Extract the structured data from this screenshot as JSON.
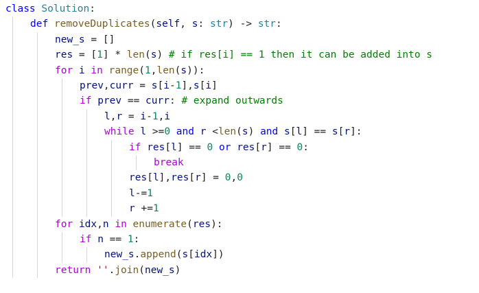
{
  "lines": [
    {
      "indent": 0,
      "tokens": [
        {
          "t": "class",
          "k": "kw"
        },
        {
          "t": " "
        },
        {
          "t": "Solution",
          "k": "cls"
        },
        {
          "t": ":"
        }
      ]
    },
    {
      "indent": 1,
      "tokens": [
        {
          "t": "def",
          "k": "kw"
        },
        {
          "t": " "
        },
        {
          "t": "removeDuplicates",
          "k": "fn"
        },
        {
          "t": "("
        },
        {
          "t": "self",
          "k": "param"
        },
        {
          "t": ", "
        },
        {
          "t": "s",
          "k": "param"
        },
        {
          "t": ": "
        },
        {
          "t": "str",
          "k": "cls"
        },
        {
          "t": ") -> "
        },
        {
          "t": "str",
          "k": "cls"
        },
        {
          "t": ":"
        }
      ]
    },
    {
      "indent": 2,
      "tokens": [
        {
          "t": "new_s",
          "k": "param"
        },
        {
          "t": " = []"
        }
      ]
    },
    {
      "indent": 2,
      "tokens": [
        {
          "t": "res",
          "k": "param"
        },
        {
          "t": " = ["
        },
        {
          "t": "1",
          "k": "num"
        },
        {
          "t": "] * "
        },
        {
          "t": "len",
          "k": "fn"
        },
        {
          "t": "("
        },
        {
          "t": "s",
          "k": "param"
        },
        {
          "t": ") "
        },
        {
          "t": "# if res[i] == 1 then it can be added into s",
          "k": "cmt"
        }
      ]
    },
    {
      "indent": 2,
      "tokens": [
        {
          "t": "for",
          "k": "ctl"
        },
        {
          "t": " "
        },
        {
          "t": "i",
          "k": "param"
        },
        {
          "t": " "
        },
        {
          "t": "in",
          "k": "ctl"
        },
        {
          "t": " "
        },
        {
          "t": "range",
          "k": "fn"
        },
        {
          "t": "("
        },
        {
          "t": "1",
          "k": "num"
        },
        {
          "t": ","
        },
        {
          "t": "len",
          "k": "fn"
        },
        {
          "t": "("
        },
        {
          "t": "s",
          "k": "param"
        },
        {
          "t": ")):"
        }
      ]
    },
    {
      "indent": 3,
      "tokens": [
        {
          "t": "prev",
          "k": "param"
        },
        {
          "t": ","
        },
        {
          "t": "curr",
          "k": "param"
        },
        {
          "t": " = "
        },
        {
          "t": "s",
          "k": "param"
        },
        {
          "t": "["
        },
        {
          "t": "i",
          "k": "param"
        },
        {
          "t": "-"
        },
        {
          "t": "1",
          "k": "num"
        },
        {
          "t": "],"
        },
        {
          "t": "s",
          "k": "param"
        },
        {
          "t": "["
        },
        {
          "t": "i",
          "k": "param"
        },
        {
          "t": "]"
        }
      ]
    },
    {
      "indent": 3,
      "tokens": [
        {
          "t": "if",
          "k": "ctl"
        },
        {
          "t": " "
        },
        {
          "t": "prev",
          "k": "param"
        },
        {
          "t": " == "
        },
        {
          "t": "curr",
          "k": "param"
        },
        {
          "t": ": "
        },
        {
          "t": "# expand outwards",
          "k": "cmt"
        }
      ]
    },
    {
      "indent": 4,
      "tokens": [
        {
          "t": "l",
          "k": "param"
        },
        {
          "t": ","
        },
        {
          "t": "r",
          "k": "param"
        },
        {
          "t": " = "
        },
        {
          "t": "i",
          "k": "param"
        },
        {
          "t": "-"
        },
        {
          "t": "1",
          "k": "num"
        },
        {
          "t": ","
        },
        {
          "t": "i",
          "k": "param"
        }
      ]
    },
    {
      "indent": 4,
      "tokens": [
        {
          "t": "while",
          "k": "ctl"
        },
        {
          "t": " "
        },
        {
          "t": "l",
          "k": "param"
        },
        {
          "t": " >="
        },
        {
          "t": "0",
          "k": "num"
        },
        {
          "t": " "
        },
        {
          "t": "and",
          "k": "kw"
        },
        {
          "t": " "
        },
        {
          "t": "r",
          "k": "param"
        },
        {
          "t": " <"
        },
        {
          "t": "len",
          "k": "fn"
        },
        {
          "t": "("
        },
        {
          "t": "s",
          "k": "param"
        },
        {
          "t": ") "
        },
        {
          "t": "and",
          "k": "kw"
        },
        {
          "t": " "
        },
        {
          "t": "s",
          "k": "param"
        },
        {
          "t": "["
        },
        {
          "t": "l",
          "k": "param"
        },
        {
          "t": "] == "
        },
        {
          "t": "s",
          "k": "param"
        },
        {
          "t": "["
        },
        {
          "t": "r",
          "k": "param"
        },
        {
          "t": "]:"
        }
      ]
    },
    {
      "indent": 5,
      "tokens": [
        {
          "t": "if",
          "k": "ctl"
        },
        {
          "t": " "
        },
        {
          "t": "res",
          "k": "param"
        },
        {
          "t": "["
        },
        {
          "t": "l",
          "k": "param"
        },
        {
          "t": "] == "
        },
        {
          "t": "0",
          "k": "num"
        },
        {
          "t": " "
        },
        {
          "t": "or",
          "k": "kw"
        },
        {
          "t": " "
        },
        {
          "t": "res",
          "k": "param"
        },
        {
          "t": "["
        },
        {
          "t": "r",
          "k": "param"
        },
        {
          "t": "] == "
        },
        {
          "t": "0",
          "k": "num"
        },
        {
          "t": ":"
        }
      ]
    },
    {
      "indent": 6,
      "tokens": [
        {
          "t": "break",
          "k": "ctl"
        }
      ]
    },
    {
      "indent": 5,
      "tokens": [
        {
          "t": "res",
          "k": "param"
        },
        {
          "t": "["
        },
        {
          "t": "l",
          "k": "param"
        },
        {
          "t": "],"
        },
        {
          "t": "res",
          "k": "param"
        },
        {
          "t": "["
        },
        {
          "t": "r",
          "k": "param"
        },
        {
          "t": "] = "
        },
        {
          "t": "0",
          "k": "num"
        },
        {
          "t": ","
        },
        {
          "t": "0",
          "k": "num"
        }
      ]
    },
    {
      "indent": 5,
      "tokens": [
        {
          "t": "l",
          "k": "param"
        },
        {
          "t": "-="
        },
        {
          "t": "1",
          "k": "num"
        }
      ]
    },
    {
      "indent": 5,
      "tokens": [
        {
          "t": "r",
          "k": "param"
        },
        {
          "t": " +="
        },
        {
          "t": "1",
          "k": "num"
        }
      ]
    },
    {
      "indent": 2,
      "tokens": [
        {
          "t": "for",
          "k": "ctl"
        },
        {
          "t": " "
        },
        {
          "t": "idx",
          "k": "param"
        },
        {
          "t": ","
        },
        {
          "t": "n",
          "k": "param"
        },
        {
          "t": " "
        },
        {
          "t": "in",
          "k": "ctl"
        },
        {
          "t": " "
        },
        {
          "t": "enumerate",
          "k": "fn"
        },
        {
          "t": "("
        },
        {
          "t": "res",
          "k": "param"
        },
        {
          "t": "):"
        }
      ]
    },
    {
      "indent": 3,
      "tokens": [
        {
          "t": "if",
          "k": "ctl"
        },
        {
          "t": " "
        },
        {
          "t": "n",
          "k": "param"
        },
        {
          "t": " == "
        },
        {
          "t": "1",
          "k": "num"
        },
        {
          "t": ":"
        }
      ]
    },
    {
      "indent": 4,
      "tokens": [
        {
          "t": "new_s",
          "k": "param"
        },
        {
          "t": "."
        },
        {
          "t": "append",
          "k": "fn"
        },
        {
          "t": "("
        },
        {
          "t": "s",
          "k": "param"
        },
        {
          "t": "["
        },
        {
          "t": "idx",
          "k": "param"
        },
        {
          "t": "])"
        }
      ]
    },
    {
      "indent": 2,
      "tokens": [
        {
          "t": "return",
          "k": "ctl"
        },
        {
          "t": " "
        },
        {
          "t": "''",
          "k": "str"
        },
        {
          "t": "."
        },
        {
          "t": "join",
          "k": "fn"
        },
        {
          "t": "("
        },
        {
          "t": "new_s",
          "k": "param"
        },
        {
          "t": ")"
        }
      ]
    }
  ]
}
